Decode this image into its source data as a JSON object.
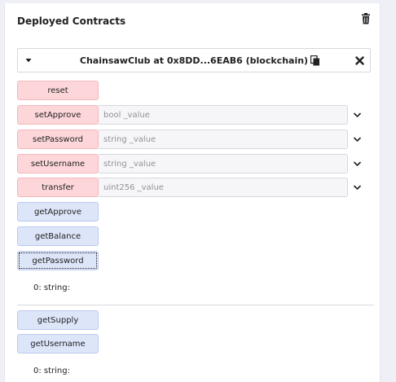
{
  "section": {
    "title": "Deployed Contracts",
    "delete_icon": "trash-icon"
  },
  "contract": {
    "name": "ChainsawClub at 0x8DD...6EAB6 (blockchain)",
    "caret_icon": "caret-down-icon",
    "copy_icon": "copy-icon",
    "close_icon": "close-icon"
  },
  "functions": [
    {
      "label": "reset",
      "kind": "transact"
    },
    {
      "label": "setApprove",
      "kind": "transact",
      "placeholder": "bool _value"
    },
    {
      "label": "setPassword",
      "kind": "transact",
      "placeholder": "string _value"
    },
    {
      "label": "setUsername",
      "kind": "transact",
      "placeholder": "string _value"
    },
    {
      "label": "transfer",
      "kind": "transact",
      "placeholder": "uint256 _value"
    },
    {
      "label": "getApprove",
      "kind": "call"
    },
    {
      "label": "getBalance",
      "kind": "call"
    },
    {
      "label": "getPassword",
      "kind": "call"
    },
    {
      "label": "getSupply",
      "kind": "call"
    },
    {
      "label": "getUsername",
      "kind": "call"
    }
  ],
  "outputs": {
    "getPassword": "0: string:",
    "getUsername": "0: string:"
  },
  "colors": {
    "transact_bg": "#fdd6d9",
    "call_bg": "#dde5f8"
  }
}
